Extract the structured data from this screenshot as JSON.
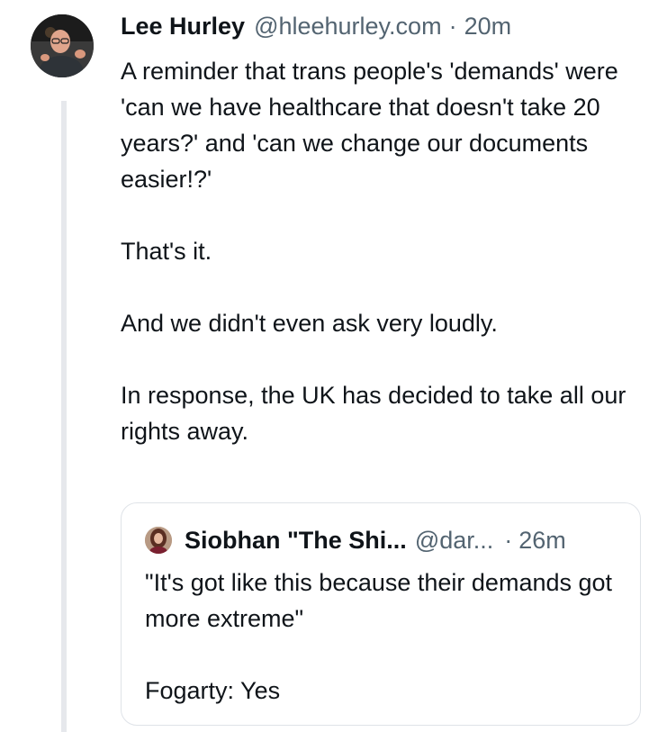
{
  "post": {
    "author_name": "Lee Hurley",
    "author_handle": "@hleehurley.com",
    "separator": "·",
    "time": "20m",
    "paragraphs": [
      "A reminder that trans people's 'demands' were 'can we have healthcare that doesn't take 20 years?' and 'can we change our documents easier!?'",
      "That's it.",
      "And we didn't even ask very loudly.",
      "In response, the UK has decided to take all our rights away."
    ]
  },
  "quote": {
    "author_name": "Siobhan \"The Shi...",
    "author_handle": "@dar...",
    "separator": "·",
    "time": "26m",
    "paragraphs": [
      "\"It's got like this because their demands got more extreme\"",
      "Fogarty: Yes"
    ]
  },
  "icons": {
    "author_avatar": "avatar",
    "quote_avatar": "avatar"
  },
  "colors": {
    "text": "#0f1419",
    "secondary": "#536471",
    "thread_line": "#e6e8ec",
    "border": "#dfe3e8"
  }
}
